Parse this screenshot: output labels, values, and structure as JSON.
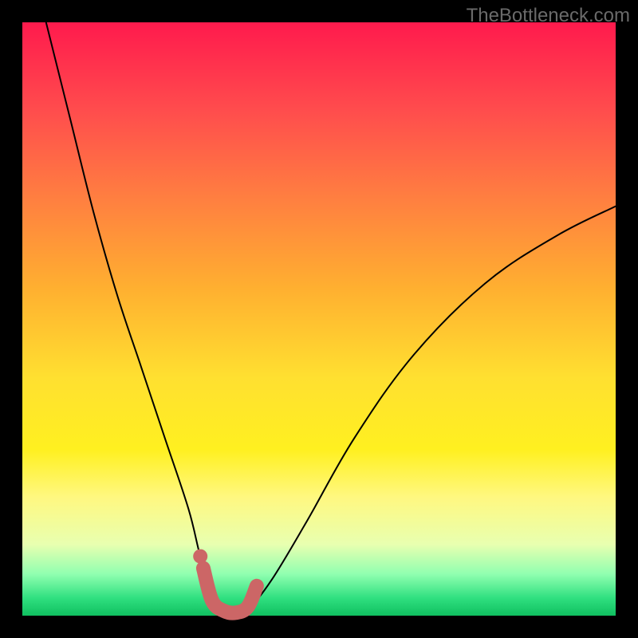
{
  "watermark": "TheBottleneck.com",
  "colors": {
    "background": "#000000",
    "gradient_top": "#ff1a4d",
    "gradient_mid": "#ffe030",
    "gradient_bottom": "#10c060",
    "curve": "#000000",
    "marker": "#cc6666"
  },
  "chart_data": {
    "type": "line",
    "title": "",
    "xlabel": "",
    "ylabel": "",
    "xlim": [
      0,
      100
    ],
    "ylim": [
      0,
      100
    ],
    "series": [
      {
        "name": "bottleneck-curve",
        "x": [
          4,
          8,
          12,
          16,
          20,
          24,
          28,
          30,
          32,
          34,
          36,
          38,
          42,
          48,
          56,
          66,
          78,
          90,
          100
        ],
        "values": [
          100,
          84,
          68,
          54,
          42,
          30,
          18,
          10,
          4,
          1,
          0,
          1,
          6,
          16,
          30,
          44,
          56,
          64,
          69
        ]
      }
    ],
    "highlight": {
      "name": "optimal-range",
      "x": [
        30.5,
        32,
        34,
        36,
        38,
        39.5
      ],
      "values": [
        8,
        2.5,
        0.8,
        0.5,
        1.5,
        5
      ]
    },
    "highlight_dot": {
      "x": 30,
      "value": 10
    }
  }
}
